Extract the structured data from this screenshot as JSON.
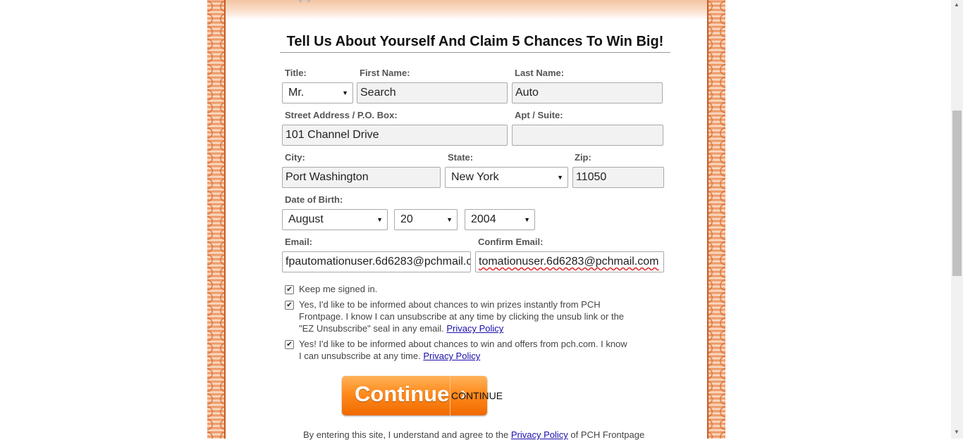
{
  "form": {
    "heading": "Tell Us About Yourself And Claim 5 Chances To Win Big!",
    "title_label": "Title:",
    "title_value": "Mr.",
    "first_name_label": "First Name:",
    "first_name_value": "Search",
    "last_name_label": "Last Name:",
    "last_name_value": "Auto",
    "street_label": "Street Address / P.O. Box:",
    "street_value": "101 Channel Drive",
    "apt_label": "Apt / Suite:",
    "apt_value": "",
    "city_label": "City:",
    "city_value": "Port Washington",
    "state_label": "State:",
    "state_value": "New York",
    "zip_label": "Zip:",
    "zip_value": "11050",
    "dob_label": "Date of Birth:",
    "dob_month": "August",
    "dob_day": "20",
    "dob_year": "2004",
    "email_label": "Email:",
    "email_value": "fpautomationuser.6d6283@pchmail.c",
    "confirm_email_label": "Confirm Email:",
    "confirm_email_value": "tomationuser.6d6283@pchmail.com"
  },
  "checkboxes": [
    {
      "checked": true,
      "text": "Keep me signed in.",
      "link": ""
    },
    {
      "checked": true,
      "text": "Yes, I'd like to be informed about chances to win prizes instantly from PCH Frontpage. I know I can unsubscribe at any time by clicking the unsub link or the \"EZ Unsubscribe\" seal in any email.",
      "link": "Privacy Policy"
    },
    {
      "checked": true,
      "text": "Yes! I'd like to be informed about chances to win and offers from pch.com. I know I can unsubscribe at any time.",
      "link": "Privacy Policy"
    }
  ],
  "button": {
    "label": "Continue",
    "alt_text": "CONTINUE"
  },
  "footer": {
    "prefix": "By entering this site, I understand and agree to the",
    "link": "Privacy Policy",
    "suffix": "of PCH Frontpage"
  },
  "colors": {
    "border_orange": "#d9682c",
    "button_orange": "#ff8a1c",
    "link_blue": "#1a0dab"
  }
}
